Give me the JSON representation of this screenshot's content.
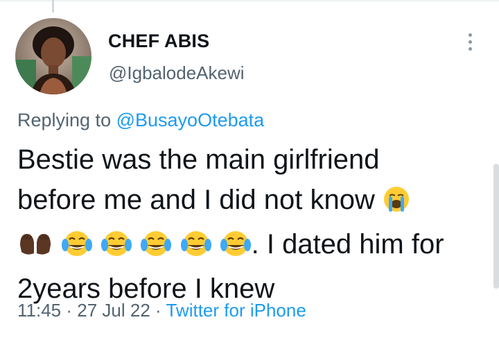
{
  "tweet": {
    "author": {
      "display_name": "CHEF ABIS",
      "handle": "@IgbalodeAkewi"
    },
    "replying_to_prefix": "Replying to",
    "replying_to_handle": "@BusayoOtebata",
    "text_line1": "Bestie was the main girlfriend",
    "text_line2": "before me and I did not know",
    "text_line3_suffix": ". I dated him for",
    "text_line4": "2years before I knew",
    "emojis": [
      "loudly-crying-face",
      "palms-up-together-dark-skin",
      "face-with-tears-of-joy",
      "face-with-tears-of-joy",
      "face-with-tears-of-joy",
      "face-with-tears-of-joy",
      "face-with-tears-of-joy"
    ],
    "time": "11:45",
    "date": "27 Jul 22",
    "separator": "·",
    "source": "Twitter for iPhone"
  },
  "colors": {
    "text": "#0f1419",
    "secondary": "#536471",
    "link": "#1d9bf0"
  }
}
